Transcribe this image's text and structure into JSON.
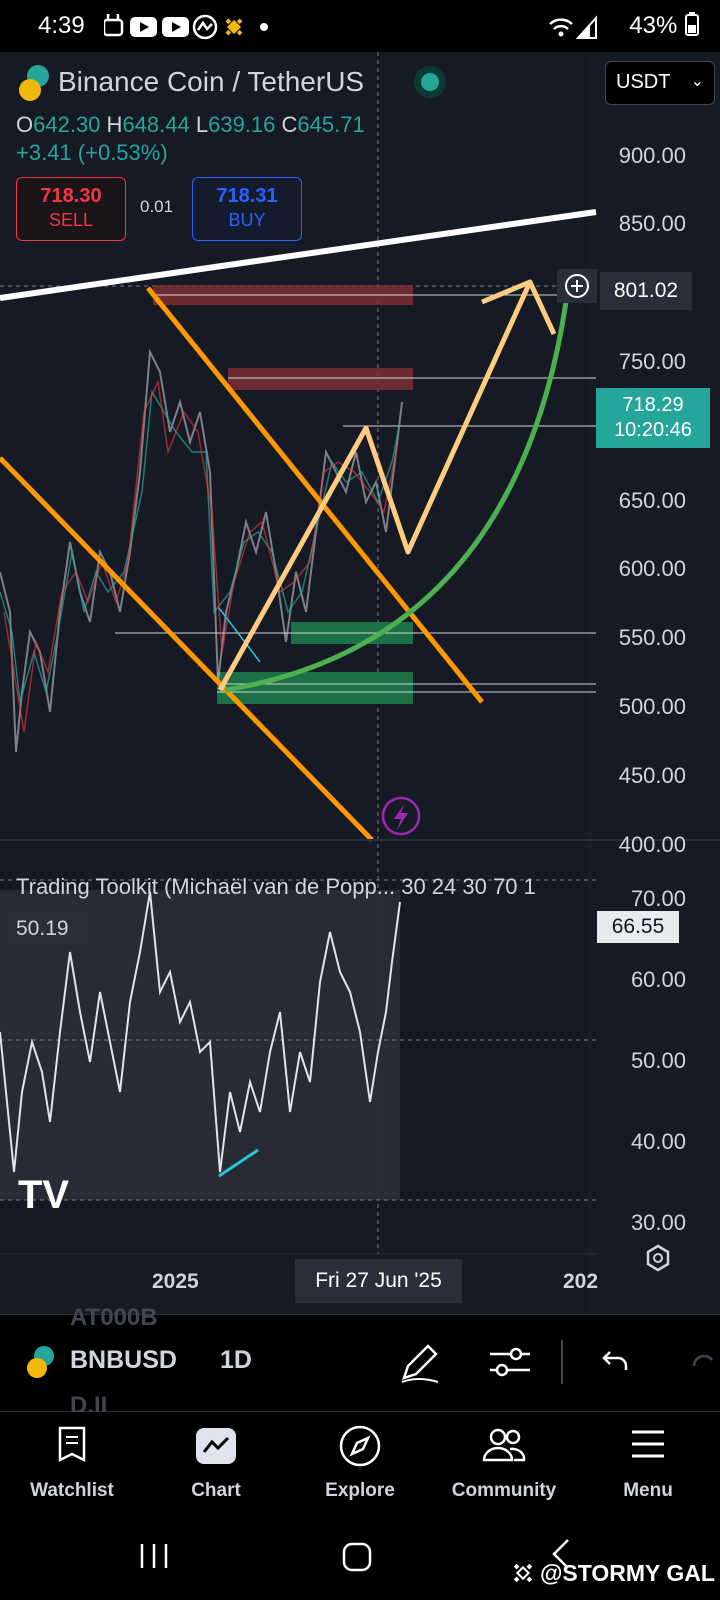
{
  "status_bar": {
    "time": "4:39",
    "battery": "43%"
  },
  "chart": {
    "title": "Binance Coin / TetherUS",
    "ohlc": {
      "o_label": "O",
      "o": "642.30",
      "h_label": "H",
      "h": "648.44",
      "l_label": "L",
      "l": "639.16",
      "c_label": "C",
      "c": "645.71"
    },
    "change": "+3.41 (+0.53%)",
    "sell": {
      "price": "718.30",
      "label": "SELL"
    },
    "buy": {
      "price": "718.31",
      "label": "BUY"
    },
    "spread": "0.01",
    "currency": "USDT",
    "price_axis": [
      "900.00",
      "850.00",
      "801.02",
      "750.00",
      "650.00",
      "600.00",
      "550.00",
      "500.00",
      "450.00",
      "400.00"
    ],
    "current_price": "718.29",
    "countdown": "10:20:46",
    "crosshair_price": "801.02",
    "time_axis": {
      "left": "2025",
      "right": "202",
      "crosshair_date": "Fri 27 Jun '25"
    }
  },
  "indicator": {
    "title": "Trading Toolkit (Michaël van de Popp... 30 24 30 70 1",
    "left_value": "50.19",
    "current_value": "66.55",
    "axis": [
      "70.00",
      "60.00",
      "50.00",
      "40.00",
      "30.00"
    ]
  },
  "toolbar": {
    "symbol": "BNBUSD",
    "interval": "1D",
    "ghost_top": "AT000B",
    "ghost_bottom": "D.II"
  },
  "nav": {
    "items": [
      {
        "label": "Watchlist",
        "icon": "watchlist-icon"
      },
      {
        "label": "Chart",
        "icon": "chart-icon"
      },
      {
        "label": "Explore",
        "icon": "compass-icon"
      },
      {
        "label": "Community",
        "icon": "community-icon"
      },
      {
        "label": "Menu",
        "icon": "menu-icon"
      }
    ]
  },
  "watermark": "@STORMY GAL",
  "colors": {
    "up": "#26a69a",
    "down": "#f23645",
    "orange": "#ff9800",
    "light_orange": "#ffcc80",
    "green": "#4caf50",
    "bg": "#161a25"
  }
}
